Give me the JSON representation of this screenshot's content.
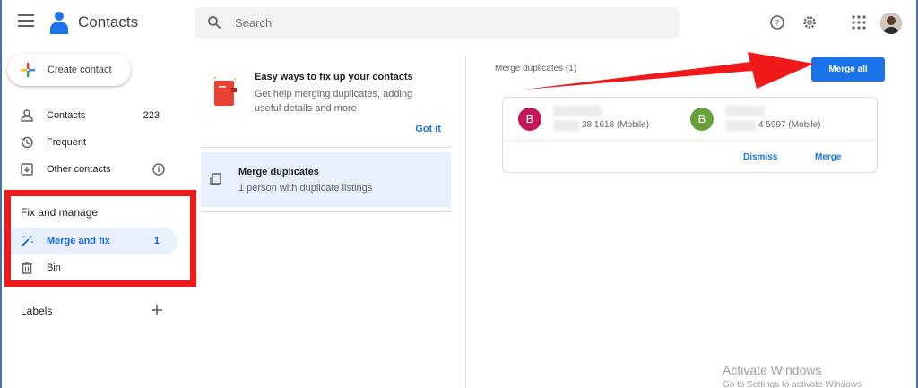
{
  "app": {
    "title": "Contacts"
  },
  "search": {
    "placeholder": "Search"
  },
  "sidebar": {
    "create_label": "Create contact",
    "items": [
      {
        "label": "Contacts",
        "count": "223",
        "icon": "person-icon"
      },
      {
        "label": "Frequent",
        "count": "",
        "icon": "history-icon"
      },
      {
        "label": "Other contacts",
        "count": "",
        "icon": "download-box-icon"
      }
    ],
    "fix_manage": {
      "heading": "Fix and manage",
      "items": [
        {
          "label": "Merge and fix",
          "count": "1",
          "icon": "magic-wand-icon",
          "active": true
        },
        {
          "label": "Bin",
          "count": "",
          "icon": "trash-icon"
        }
      ]
    },
    "labels_heading": "Labels"
  },
  "tip": {
    "title": "Easy ways to fix up your contacts",
    "text": "Get help merging duplicates, adding useful details and more",
    "action": "Got it"
  },
  "merge_item": {
    "title": "Merge duplicates",
    "subtitle": "1 person with duplicate listings"
  },
  "merge_panel": {
    "heading": "Merge duplicates (1)",
    "merge_all_label": "Merge all",
    "contacts": [
      {
        "initial": "B",
        "color": "#c2185b",
        "phone": "38 1618 (Mobile)"
      },
      {
        "initial": "B",
        "color": "#689f38",
        "phone": "4 5997 (Mobile)"
      }
    ],
    "dismiss_label": "Dismiss",
    "merge_label": "Merge"
  },
  "watermark": {
    "line1": "Activate Windows",
    "line2": "Go to Settings to activate Windows"
  },
  "colors": {
    "accent": "#1a73e8",
    "highlight": "#f01818",
    "active_bg": "#e8f0fe"
  }
}
